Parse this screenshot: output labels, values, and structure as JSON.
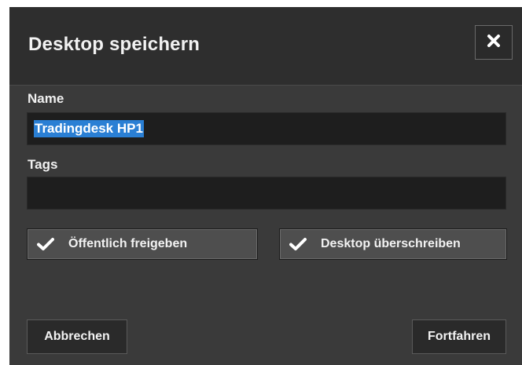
{
  "dialog": {
    "title": "Desktop speichern",
    "close_icon": "close-icon"
  },
  "form": {
    "name_label": "Name",
    "name_value": "Tradingdesk HP1",
    "tags_label": "Tags",
    "tags_value": ""
  },
  "options": {
    "share_label": "Öffentlich freigeben",
    "share_checked": true,
    "overwrite_label": "Desktop überschreiben",
    "overwrite_checked": true,
    "check_icon": "checkmark-icon"
  },
  "footer": {
    "cancel_label": "Abbrechen",
    "continue_label": "Fortfahren"
  },
  "colors": {
    "dialog_bg": "#3a3a3a",
    "header_bg": "#2e2e2e",
    "input_bg": "#1e1e1e",
    "selection": "#2a7fd4",
    "text": "#f2f2f2"
  }
}
